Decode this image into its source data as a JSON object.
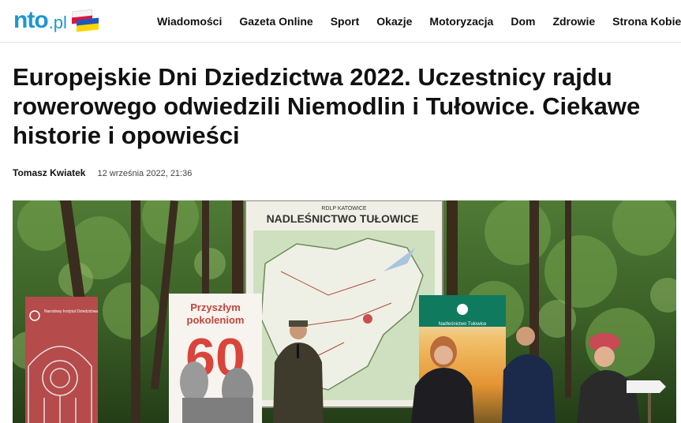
{
  "header": {
    "logo_text": "nto",
    "logo_suffix": ".pl",
    "nav_items": [
      "Wiadomości",
      "Gazeta Online",
      "Sport",
      "Okazje",
      "Motoryzacja",
      "Dom",
      "Zdrowie",
      "Strona Kobiet"
    ]
  },
  "article": {
    "title": "Europejskie Dni Dziedzictwa 2022. Uczestnicy rajdu rowerowego odwiedzili Niemodlin i Tułowice. Ciekawe historie i opowieści",
    "author": "Tomasz Kwiatek",
    "date": "12 września 2022, 21:36"
  },
  "photo": {
    "board_top": "RDLP KATOWICE",
    "board_title": "NADLEŚNICTWO TUŁOWICE",
    "banner_left": "Narodowy Instytut Dziedzictwa",
    "banner_mid_line1": "Przyszłym",
    "banner_mid_line2": "pokoleniom",
    "banner_mid_number": "60",
    "banner_right": "Nadleśnictwo Tułowice"
  },
  "colors": {
    "brand": "#1e96d2",
    "text": "#111111"
  }
}
